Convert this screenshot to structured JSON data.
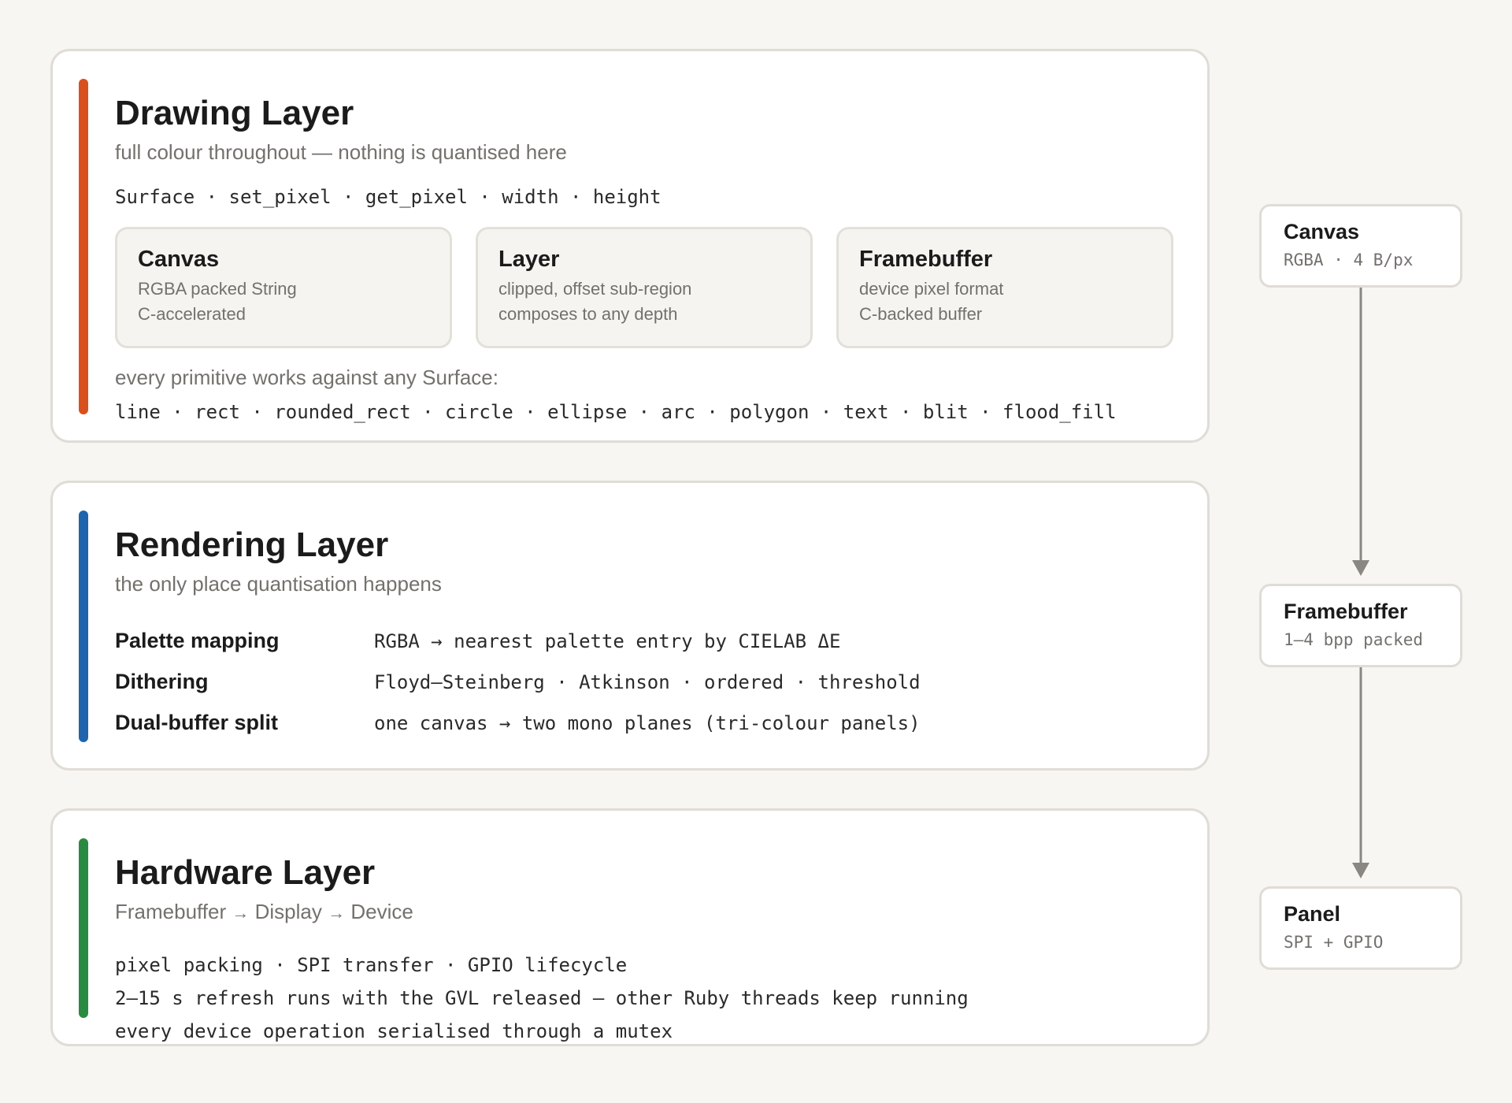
{
  "colors": {
    "background": "#f7f6f3",
    "drawing_accent": "#d9501f",
    "rendering_accent": "#1f64ad",
    "hardware_accent": "#2a8a42",
    "arrow": "#8a8783"
  },
  "drawing": {
    "title": "Drawing Layer",
    "subtitle": "full colour throughout — nothing is quantised here",
    "api": "Surface · set_pixel · get_pixel · width · height",
    "boxes": [
      {
        "title": "Canvas",
        "line1": "RGBA packed String",
        "line2": "C-accelerated"
      },
      {
        "title": "Layer",
        "line1": "clipped, offset sub-region",
        "line2": "composes to any depth"
      },
      {
        "title": "Framebuffer",
        "line1": "device pixel format",
        "line2": "C-backed buffer"
      }
    ],
    "primitives_note": "every primitive works against any Surface:",
    "primitives": "line · rect · rounded_rect · circle · ellipse · arc · polygon · text · blit · flood_fill"
  },
  "rendering": {
    "title": "Rendering Layer",
    "subtitle": "the only place quantisation happens",
    "rows": [
      {
        "label": "Palette mapping",
        "value": "RGBA → nearest palette entry by CIELAB ΔE"
      },
      {
        "label": "Dithering",
        "value": "Floyd–Steinberg · Atkinson · ordered · threshold"
      },
      {
        "label": "Dual-buffer split",
        "value": "one canvas → two mono planes (tri-colour panels)"
      }
    ]
  },
  "hardware": {
    "title": "Hardware Layer",
    "subtitle_parts": [
      "Framebuffer",
      "Display",
      "Device"
    ],
    "arrow_glyph": "→",
    "lines": [
      "pixel packing · SPI transfer · GPIO lifecycle",
      "2–15 s refresh runs with the GVL released — other Ruby threads keep running",
      "every device operation serialised through a mutex"
    ]
  },
  "flow": {
    "nodes": [
      {
        "title": "Canvas",
        "subtitle": "RGBA · 4 B/px"
      },
      {
        "title": "Framebuffer",
        "subtitle": "1–4 bpp packed"
      },
      {
        "title": "Panel",
        "subtitle": "SPI + GPIO"
      }
    ]
  }
}
